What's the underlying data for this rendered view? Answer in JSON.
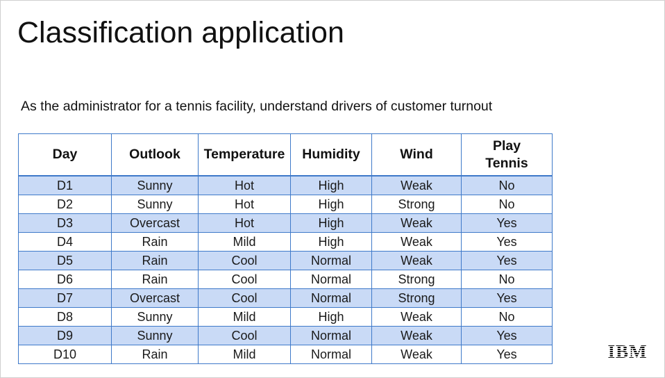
{
  "slide": {
    "title": "Classification application",
    "subtitle": "As the administrator for a tennis facility, understand drivers of customer turnout",
    "logo_text": "IBM"
  },
  "colors": {
    "table_border": "#3e79c9",
    "row_band": "#c9daf6",
    "row_plain": "#ffffff",
    "text": "#111111"
  },
  "table": {
    "headers": [
      "Day",
      "Outlook",
      "Temperature",
      "Humidity",
      "Wind",
      "Play Tennis"
    ],
    "rows": [
      [
        "D1",
        "Sunny",
        "Hot",
        "High",
        "Weak",
        "No"
      ],
      [
        "D2",
        "Sunny",
        "Hot",
        "High",
        "Strong",
        "No"
      ],
      [
        "D3",
        "Overcast",
        "Hot",
        "High",
        "Weak",
        "Yes"
      ],
      [
        "D4",
        "Rain",
        "Mild",
        "High",
        "Weak",
        "Yes"
      ],
      [
        "D5",
        "Rain",
        "Cool",
        "Normal",
        "Weak",
        "Yes"
      ],
      [
        "D6",
        "Rain",
        "Cool",
        "Normal",
        "Strong",
        "No"
      ],
      [
        "D7",
        "Overcast",
        "Cool",
        "Normal",
        "Strong",
        "Yes"
      ],
      [
        "D8",
        "Sunny",
        "Mild",
        "High",
        "Weak",
        "No"
      ],
      [
        "D9",
        "Sunny",
        "Cool",
        "Normal",
        "Weak",
        "Yes"
      ],
      [
        "D10",
        "Rain",
        "Mild",
        "Normal",
        "Weak",
        "Yes"
      ]
    ]
  }
}
